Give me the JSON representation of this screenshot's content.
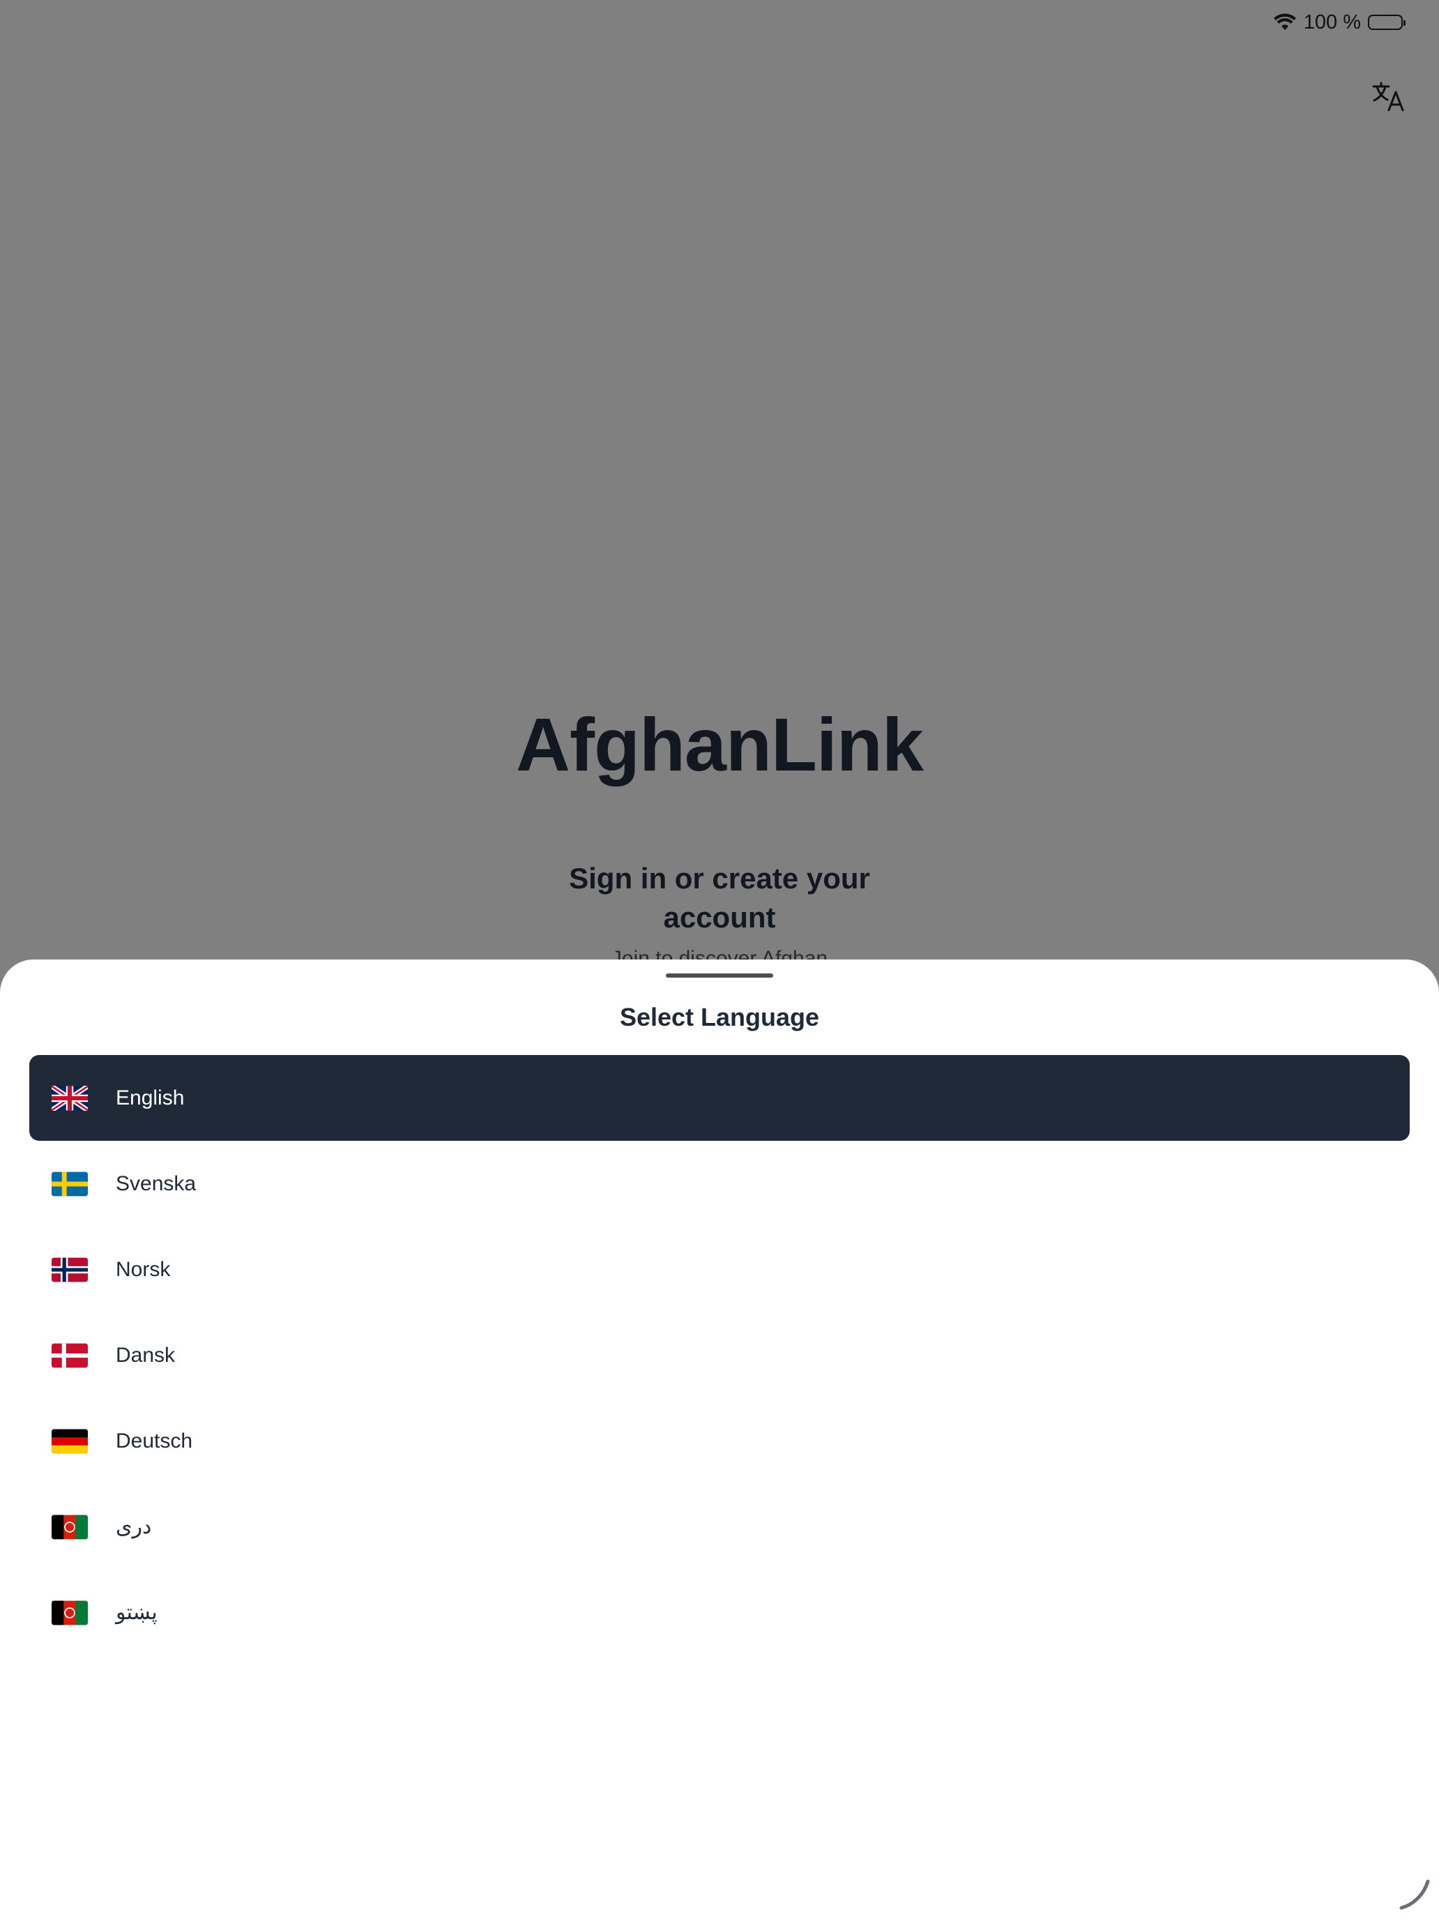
{
  "status_bar": {
    "battery_text": "100 %"
  },
  "header": {
    "translate_icon": "translate-icon"
  },
  "main": {
    "app_title": "AfghanLink",
    "subtitle": "Sign in or create your account",
    "partial_text": "Join to discover Afghan"
  },
  "language_sheet": {
    "title": "Select Language",
    "selected": "English",
    "languages": [
      {
        "label": "English",
        "flag": "uk-flag-icon"
      },
      {
        "label": "Svenska",
        "flag": "sweden-flag-icon"
      },
      {
        "label": "Norsk",
        "flag": "norway-flag-icon"
      },
      {
        "label": "Dansk",
        "flag": "denmark-flag-icon"
      },
      {
        "label": "Deutsch",
        "flag": "germany-flag-icon"
      },
      {
        "label": "دری",
        "flag": "afghanistan-flag-icon"
      },
      {
        "label": "پښتو",
        "flag": "afghanistan-flag-icon"
      }
    ]
  },
  "colors": {
    "overlay": "#808080",
    "selected_row": "#1f2937",
    "text_dark": "#1f2937"
  }
}
